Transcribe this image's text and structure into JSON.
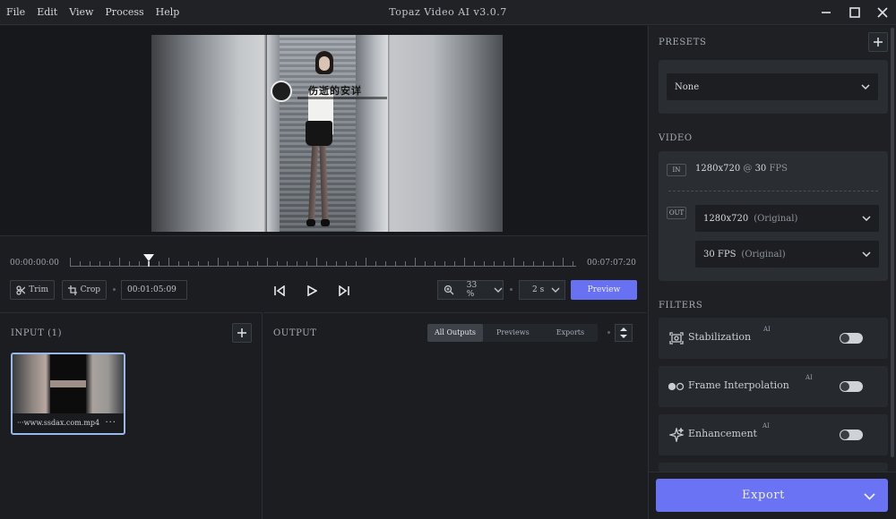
{
  "menu": [
    "File",
    "Edit",
    "View",
    "Process",
    "Help"
  ],
  "app_title": "Topaz Video AI   v3.0.7",
  "watermark": {
    "title": "伤逝的安详"
  },
  "timeline": {
    "start_time": "00:00:00:00",
    "end_time": "00:07:07:20",
    "current_time": "00:01:05:09",
    "trim_label": "Trim",
    "crop_label": "Crop",
    "zoom": "33 %",
    "speed": "2 s",
    "preview_label": "Preview",
    "playhead_fraction": 0.155
  },
  "input": {
    "label": "INPUT (1)",
    "clip_name": "···www.ssdax.com.mp4",
    "more": "···"
  },
  "output": {
    "label": "OUTPUT",
    "tabs": [
      "All Outputs",
      "Previews",
      "Exports"
    ],
    "active_tab": "All Outputs"
  },
  "sidebar": {
    "presets_label": "PRESETS",
    "preset_value": "None",
    "video_label": "VIDEO",
    "in_tag": "IN",
    "out_tag": "OUT",
    "in_res": "1280x720",
    "in_at": "@",
    "in_fps": "30",
    "in_fps_unit": "FPS",
    "out_res": "1280x720",
    "out_res_note": "(Original)",
    "out_fps": "30 FPS",
    "out_fps_note": "(Original)",
    "filters_label": "FILTERS",
    "filters": [
      {
        "name": "Stabilization",
        "ai": "AI",
        "icon": "stabilization-icon",
        "enabled": false
      },
      {
        "name": "Frame Interpolation",
        "ai": "AI",
        "icon": "frame-interpolation-icon",
        "enabled": false
      },
      {
        "name": "Enhancement",
        "ai": "AI",
        "icon": "enhancement-icon",
        "enabled": false
      }
    ],
    "export_label": "Export"
  },
  "colors": {
    "accent": "#6a73f3",
    "background": "#1b1d21",
    "panel": "#2a2d32",
    "clip_border": "#9bb7e8"
  }
}
